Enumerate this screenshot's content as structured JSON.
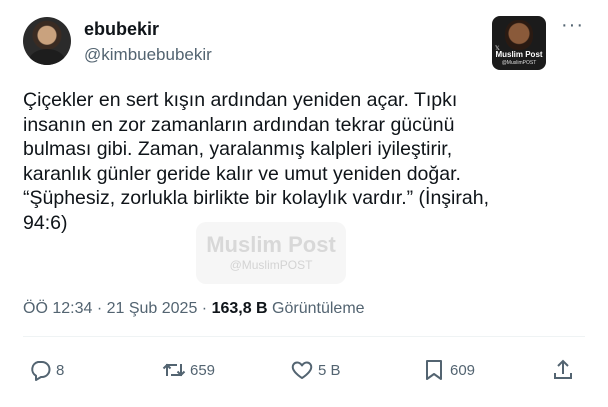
{
  "user": {
    "display_name": "ebubekir",
    "handle": "@kimbuebubekir"
  },
  "badge": {
    "name": "Muslim Post",
    "handle": "@MuslimPOST",
    "x_mark": "𝕏"
  },
  "more_label": "···",
  "tweet": {
    "text": "Çiçekler en sert kışın ardından yeniden açar. Tıpkı\ninsanın en zor zamanların ardından tekrar gücünü\nbulması gibi. Zaman, yaralanmış kalpleri iyileştirir,\nkaranlık günler geride kalır ve umut yeniden doğar.\n“Şüphesiz, zorlukla birlikte bir kolaylık vardır.” (İnşirah,\n94:6)"
  },
  "watermark": {
    "title": "Muslim Post",
    "handle": "@MuslimPOST"
  },
  "meta": {
    "time": "ÖÖ 12:34",
    "sep1": " · ",
    "date": "21 Şub 2025",
    "sep2": " · ",
    "views_count": "163,8 B",
    "views_label": " Görüntüleme"
  },
  "actions": {
    "reply_count": "8",
    "retweet_count": "659",
    "like_count": "5 B",
    "bookmark_count": "609"
  },
  "icons": {
    "reply": "reply-icon",
    "retweet": "retweet-icon",
    "like": "heart-icon",
    "bookmark": "bookmark-icon",
    "share": "share-icon"
  }
}
